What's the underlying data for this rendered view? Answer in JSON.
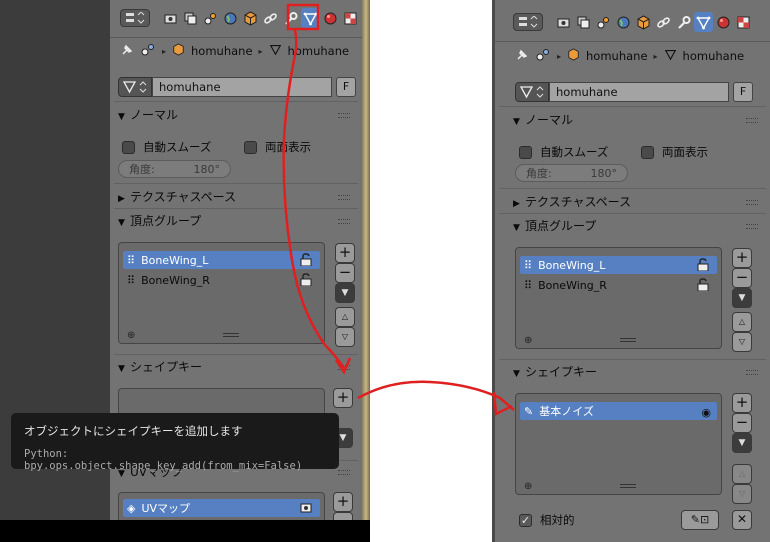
{
  "left": {
    "breadcrumb": {
      "object": "homuhane",
      "mesh": "homuhane"
    },
    "mesh_name": "homuhane",
    "fake_user": "F",
    "normals": {
      "title": "ノーマル",
      "auto_smooth": "自動スムーズ",
      "double_sided": "両面表示",
      "angle_label": "角度:",
      "angle_value": "180°"
    },
    "texture_space": {
      "title": "テクスチャスペース"
    },
    "vertex_groups": {
      "title": "頂点グループ",
      "items": [
        "BoneWing_L",
        "BoneWing_R"
      ]
    },
    "shape_keys": {
      "title": "シェイプキー"
    },
    "uv_maps": {
      "title": "UVマップ",
      "items": [
        "UVマップ"
      ]
    }
  },
  "tooltip": {
    "title": "オブジェクトにシェイプキーを追加します",
    "python": "Python: bpy.ops.object.shape_key_add(from_mix=False)"
  },
  "right": {
    "breadcrumb": {
      "object": "homuhane",
      "mesh": "homuhane"
    },
    "mesh_name": "homuhane",
    "fake_user": "F",
    "normals": {
      "title": "ノーマル",
      "auto_smooth": "自動スムーズ",
      "double_sided": "両面表示",
      "angle_label": "角度:",
      "angle_value": "180°"
    },
    "texture_space": {
      "title": "テクスチャスペース"
    },
    "vertex_groups": {
      "title": "頂点グループ",
      "items": [
        "BoneWing_L",
        "BoneWing_R"
      ]
    },
    "shape_keys": {
      "title": "シェイプキー",
      "items": [
        "基本ノイズ"
      ],
      "relative_label": "相対的"
    }
  },
  "colors": {
    "selected": "#5680c2",
    "annotation": "#e02020",
    "panel": "#737373"
  }
}
